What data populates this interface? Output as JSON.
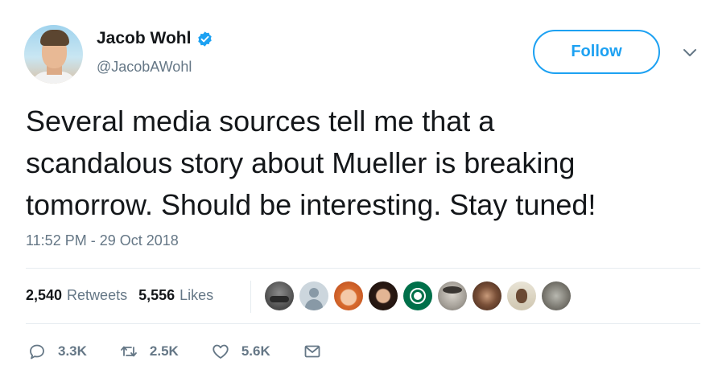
{
  "author": {
    "display_name": "Jacob Wohl",
    "handle": "@JacobAWohl",
    "verified": true
  },
  "follow_button": {
    "label": "Follow"
  },
  "tweet": {
    "lines": [
      "Several media sources tell me that a",
      "scandalous story about Mueller is breaking",
      "tomorrow. Should be interesting. Stay tuned!"
    ],
    "timestamp": "11:52 PM - 29 Oct 2018"
  },
  "stats": {
    "retweets_count": "2,540",
    "retweets_label": "Retweets",
    "likes_count": "5,556",
    "likes_label": "Likes"
  },
  "liker_avatars": [
    "liker-avatar-1",
    "liker-avatar-2",
    "liker-avatar-3",
    "liker-avatar-4",
    "liker-avatar-5",
    "liker-avatar-6",
    "liker-avatar-7",
    "liker-avatar-8",
    "liker-avatar-9"
  ],
  "actions": {
    "reply_count": "3.3K",
    "retweet_count": "2.5K",
    "like_count": "5.6K"
  },
  "colors": {
    "accent": "#1da1f2",
    "text_primary": "#14171a",
    "text_secondary": "#657786",
    "divider": "#e6ecf0"
  },
  "icons": [
    "verified-badge-icon",
    "chevron-down-icon",
    "reply-icon",
    "retweet-icon",
    "like-icon",
    "direct-message-icon"
  ]
}
